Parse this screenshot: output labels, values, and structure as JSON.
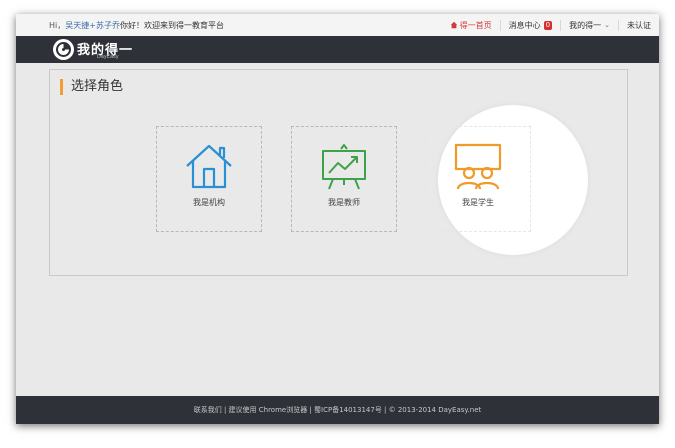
{
  "topbar": {
    "greeting_hi": "Hi，",
    "user_name": "吴天捷+苏子乔",
    "greeting_text": "你好！欢迎来到得一教育平台",
    "nav": {
      "home": "得一首页",
      "messages": "消息中心",
      "message_count": "0",
      "my_account": "我的得一",
      "verify": "未认证"
    }
  },
  "header": {
    "logo_text": "我的得一",
    "logo_sub": "DayEasy"
  },
  "main": {
    "section_title": "选择角色",
    "roles": [
      {
        "label": "我是机构",
        "icon": "house-icon"
      },
      {
        "label": "我是教师",
        "icon": "presentation-board-icon"
      },
      {
        "label": "我是学生",
        "icon": "students-board-icon"
      }
    ]
  },
  "footer": {
    "text": "联系我们 | 建议使用 Chrome浏览器 | 蜀ICP备14013147号 | © 2013-2014 DayEasy.net"
  },
  "colors": {
    "accent": "#f0a030",
    "header_bg": "#2e3138",
    "institution_blue": "#2a8fd4",
    "teacher_green": "#3ea24a",
    "student_orange": "#f09a2a",
    "badge_red": "#d32f2f"
  }
}
